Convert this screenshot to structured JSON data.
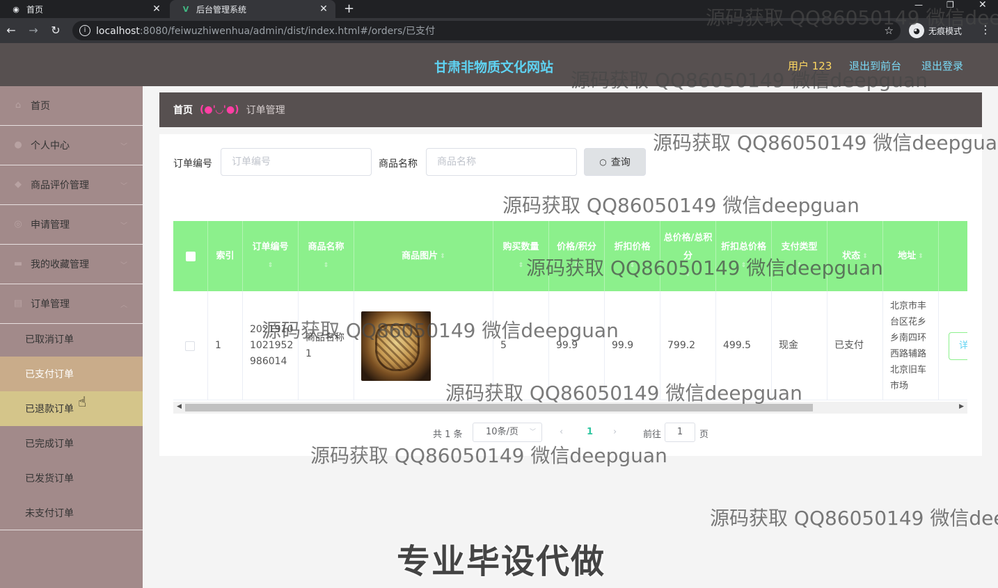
{
  "browser": {
    "tabs": [
      {
        "title": "首页"
      },
      {
        "title": "后台管理系统"
      }
    ],
    "url_host": "localhost",
    "url_rest": ":8080/feiwuzhiwenhua/admin/dist/index.html#/orders/已支付",
    "incognito_label": "无痕模式"
  },
  "header": {
    "site_title": "甘肃非物质文化网站",
    "user": "用户 123",
    "to_front": "退出到前台",
    "logout": "退出登录"
  },
  "sidebar": {
    "items": [
      {
        "label": "首页"
      },
      {
        "label": "个人中心"
      },
      {
        "label": "商品评价管理"
      },
      {
        "label": "申请管理"
      },
      {
        "label": "我的收藏管理"
      },
      {
        "label": "订单管理"
      }
    ],
    "sub_items": [
      {
        "label": "已取消订单"
      },
      {
        "label": "已支付订单"
      },
      {
        "label": "已退款订单"
      },
      {
        "label": "已完成订单"
      },
      {
        "label": "已发货订单"
      },
      {
        "label": "未支付订单"
      }
    ]
  },
  "breadcrumb": {
    "home": "首页",
    "separator": "(●'◡'●)",
    "current": "订单管理"
  },
  "search": {
    "order_no_label": "订单编号",
    "order_no_placeholder": "订单编号",
    "product_label": "商品名称",
    "product_placeholder": "商品名称",
    "query_button": "查询"
  },
  "table": {
    "columns": [
      "索引",
      "订单编号",
      "商品名称",
      "商品图片",
      "购买数量",
      "价格/积分",
      "折扣价格",
      "总价格/总积分",
      "折扣总价格",
      "支付类型",
      "状态",
      "地址"
    ],
    "row": {
      "index": "1",
      "order_no": "20210910219529860 14",
      "order_no_lines": [
        "2021910",
        "1021952",
        "986014"
      ],
      "product_lines": [
        "商品名称",
        "1"
      ],
      "quantity": "5",
      "price": "99.9",
      "discount_price": "99.9",
      "total": "799.2",
      "discount_total": "499.5",
      "pay_type": "现金",
      "status": "已支付",
      "address_lines": [
        "北京市丰",
        "台区花乡",
        "乡南四环",
        "西路辅路",
        "北京旧车",
        "市场"
      ],
      "detail_btn": "详"
    }
  },
  "pagination": {
    "total": "共 1 条",
    "page_size": "10条/页",
    "current_page": "1",
    "goto_prefix": "前往",
    "goto_value": "1",
    "goto_suffix": "页"
  },
  "watermarks": {
    "text": "源码获取 QQ86050149 微信deepguan",
    "big": "专业毕设代做"
  },
  "colors": {
    "header_bg": "#575050",
    "sidebar_bg": "#a28a8a",
    "table_header": "#8cf08c",
    "active_sub": "#c9ac8a",
    "title": "#5fd3f3"
  }
}
